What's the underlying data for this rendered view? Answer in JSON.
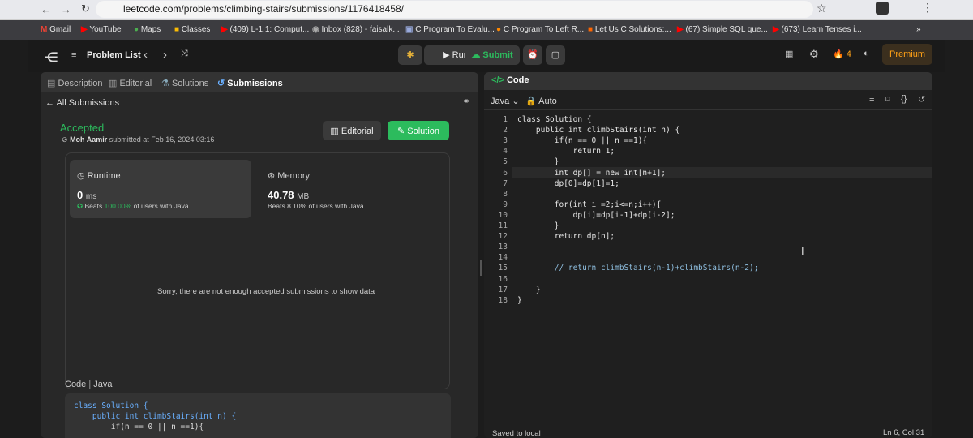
{
  "browser": {
    "url_host": "leetcode.com",
    "url_path": "/problems/climbing-stairs/submissions/1176418458/",
    "bookmarks": [
      "Gmail",
      "YouTube",
      "Maps",
      "Classes",
      "(409) L-1.1: Comput...",
      "Inbox (828) - faisalk...",
      "C Program To Evalu...",
      "C Program To Left R...",
      "Let Us C Solutions:...",
      "(67) Simple SQL que...",
      "(673) Learn Tenses i..."
    ]
  },
  "nav": {
    "problem_list": "Problem List",
    "run": "Run",
    "submit": "Submit",
    "streak": "4",
    "premium": "Premium"
  },
  "left": {
    "tabs": [
      "Description",
      "Editorial",
      "Solutions",
      "Submissions"
    ],
    "back": "All Submissions",
    "status": "Accepted",
    "user": "Moh Aamir",
    "submitted": "submitted at Feb 16, 2024 03:16",
    "editorial_btn": "Editorial",
    "solution_btn": "Solution",
    "runtime_label": "Runtime",
    "runtime_value": "0",
    "runtime_unit": "ms",
    "runtime_beats_prefix": "Beats",
    "runtime_beats": "100.00%",
    "runtime_beats_suffix": "of users with Java",
    "memory_label": "Memory",
    "memory_value": "40.78",
    "memory_unit": "MB",
    "memory_beats": "Beats 8.10% of users with Java",
    "empty_msg": "Sorry, there are not enough accepted submissions to show data",
    "code_tab": "Code",
    "lang_tab": "Java",
    "code_lines": [
      "class Solution {",
      "    public int climbStairs(int n) {",
      "        if(n == 0 || n ==1){"
    ]
  },
  "right": {
    "title": "Code",
    "lang": "Java",
    "auto": "Auto",
    "line_numbers": [
      "1",
      "2",
      "3",
      "4",
      "5",
      "6",
      "7",
      "8",
      "9",
      "10",
      "11",
      "12",
      "13",
      "14",
      "15",
      "16",
      "17",
      "18"
    ],
    "lines": [
      "class Solution {",
      "    public int climbStairs(int n) {",
      "        if(n == 0 || n ==1){",
      "            return 1;",
      "        }",
      "        int dp[] = new int[n+1];",
      "        dp[0]=dp[1]=1;",
      "",
      "        for(int i =2;i<=n;i++){",
      "            dp[i]=dp[i-1]+dp[i-2];",
      "        }",
      "        return dp[n];",
      "",
      "",
      "        // return climbStairs(n-1)+climbStairs(n-2);",
      "",
      "    }",
      "}"
    ],
    "saved": "Saved to local",
    "cursor_pos": "Ln 6, Col 31"
  },
  "colors": {
    "accent_green": "#2cbb5d",
    "premium": "#ffa116",
    "bg": "#1a1a1a",
    "panel": "#282828"
  }
}
